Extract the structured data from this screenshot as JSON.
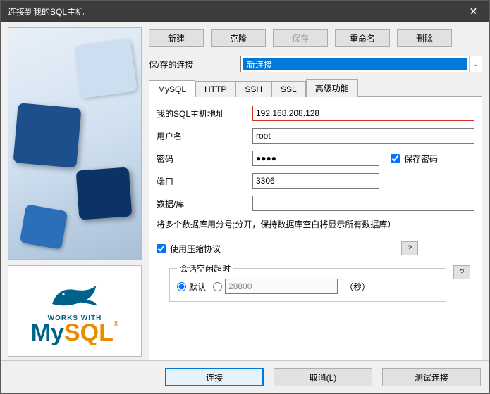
{
  "titlebar": {
    "title": "连接到我的SQL主机"
  },
  "toolbar": {
    "new_label": "新建",
    "clone_label": "克隆",
    "save_label": "保存",
    "rename_label": "重命名",
    "delete_label": "删除"
  },
  "saved": {
    "label": "保/存的连接",
    "selected": "新连接"
  },
  "tabs": [
    {
      "label": "MySQL"
    },
    {
      "label": "HTTP"
    },
    {
      "label": "SSH"
    },
    {
      "label": "SSL"
    },
    {
      "label": "高级功能"
    }
  ],
  "form": {
    "host_label": "我的SQL主机地址",
    "host_value": "192.168.208.128",
    "user_label": "用户名",
    "user_value": "root",
    "pass_label": "密码",
    "pass_value": "●●●●",
    "save_pass_label": "保存密码",
    "port_label": "端口",
    "port_value": "3306",
    "db_label": "数据/库",
    "hint": "将多个数据库用分号;分开，保持数据库空白将显示所有数据库）",
    "compress_label": "使用压缩协议",
    "help_label": "?",
    "idle_legend": "会话空闲超时",
    "radio_default": "默认",
    "timeout_value": "28800",
    "seconds": "（秒）"
  },
  "logo": {
    "works_with": "WORKS WITH",
    "my": "My",
    "sql": "SQL",
    "reg": "®"
  },
  "bottom": {
    "connect": "连接",
    "cancel": "取消(L)",
    "test": "测试连接"
  }
}
